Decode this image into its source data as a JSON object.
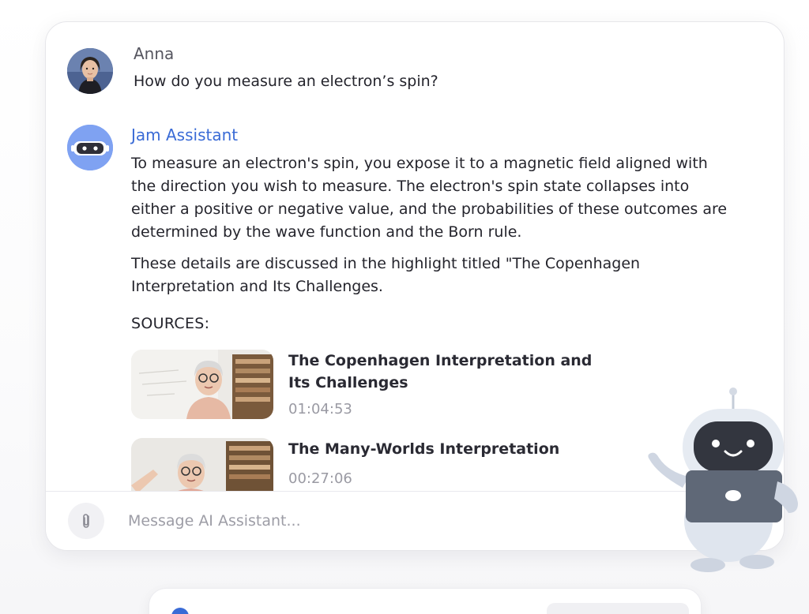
{
  "conversation": {
    "user_message": {
      "name": "Anna",
      "text": "How do you measure an electron’s spin?"
    },
    "assistant_message": {
      "name": "Jam Assistant",
      "paragraph1": "To measure an electron's spin, you expose it to a magnetic field aligned with the direction you wish to measure. The electron's spin state collapses into either a positive or negative value, and the probabilities of these outcomes are determined by the wave function and the Born rule.",
      "paragraph2": "These details are discussed in the highlight titled \"The Copenhagen Interpretation and Its Challenges.",
      "sources_label": "SOURCES:",
      "sources": [
        {
          "title": "The Copenhagen Interpretation and Its Challenges",
          "time": "01:04:53"
        },
        {
          "title": "The Many-Worlds Interpretation",
          "time": "00:27:06"
        }
      ]
    }
  },
  "composer": {
    "placeholder": "Message AI Assistant...",
    "value": ""
  },
  "icons": {
    "attach": "paperclip-icon",
    "assistant_avatar": "robot-icon",
    "mascot": "robot-mascot-illustration"
  },
  "colors": {
    "assistant_name": "#3a6bd6",
    "bot_avatar_bg": "#7fa2f2",
    "timestamp": "#9a9aa3",
    "placeholder": "#9d9da6"
  }
}
